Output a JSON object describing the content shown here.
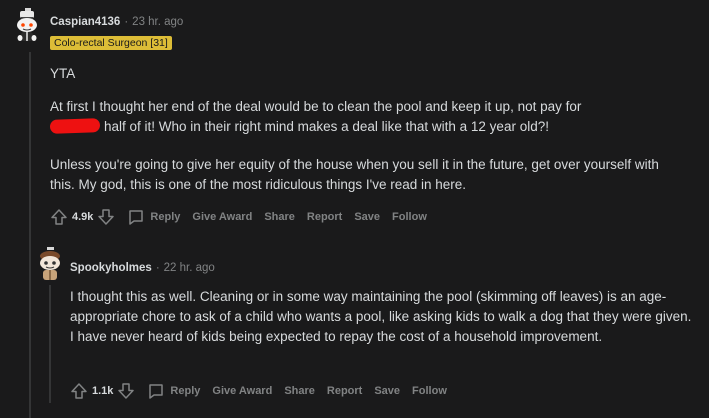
{
  "comments": [
    {
      "username": "Caspian4136",
      "separator": "·",
      "time": "23 hr. ago",
      "flair": "Colo-rectal Surgeon [31]",
      "body": {
        "p1": "YTA",
        "p2_line1": "At first I thought her end of the deal would be to clean the pool and keep it up, not pay for",
        "p2_line2": "half of it! Who in their right mind makes a deal like that with a 12 year old?!",
        "p3": "Unless you're going to give her equity of the house when you sell it in the future, get over yourself with this. My god, this is one of the most ridiculous things I've read in here."
      },
      "score": "4.9k",
      "actions": {
        "reply": "Reply",
        "give_award": "Give Award",
        "share": "Share",
        "report": "Report",
        "save": "Save",
        "follow": "Follow"
      }
    },
    {
      "username": "Spookyholmes",
      "separator": "·",
      "time": "22 hr. ago",
      "body": {
        "p1": "I thought this as well. Cleaning or in some way maintaining the pool (skimming off leaves) is an age-appropriate chore to ask of a child who wants a pool, like asking kids to walk a dog that they were given. I have never heard of kids being expected to repay the cost of a household improvement."
      },
      "score": "1.1k",
      "actions": {
        "reply": "Reply",
        "give_award": "Give Award",
        "share": "Share",
        "report": "Report",
        "save": "Save",
        "follow": "Follow"
      }
    }
  ],
  "colors": {
    "background": "#1a1a1b",
    "text": "#d7dadc",
    "muted": "#818384",
    "flair_bg": "#ddbd37",
    "redaction": "#ee1111"
  },
  "icons": [
    "upvote-icon",
    "downvote-icon",
    "comment-bubble-icon",
    "avatar-snoo-icon"
  ]
}
